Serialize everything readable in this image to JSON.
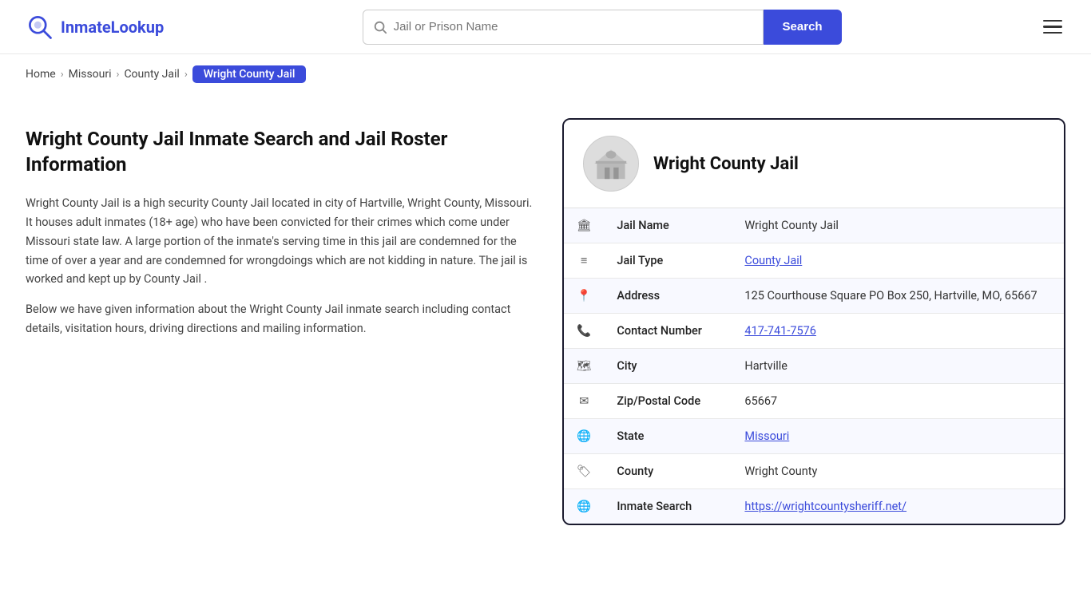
{
  "header": {
    "logo_text_prefix": "Inmate",
    "logo_text_suffix": "Lookup",
    "search_placeholder": "Jail or Prison Name",
    "search_button_label": "Search"
  },
  "breadcrumb": {
    "home": "Home",
    "state": "Missouri",
    "type": "County Jail",
    "current": "Wright County Jail"
  },
  "left_col": {
    "heading": "Wright County Jail Inmate Search and Jail Roster Information",
    "paragraph1": "Wright County Jail is a high security County Jail located in city of Hartville, Wright County, Missouri. It houses adult inmates (18+ age) who have been convicted for their crimes which come under Missouri state law. A large portion of the inmate's serving time in this jail are condemned for the time of over a year and are condemned for wrongdoings which are not kidding in nature. The jail is worked and kept up by County Jail .",
    "paragraph2": "Below we have given information about the Wright County Jail inmate search including contact details, visitation hours, driving directions and mailing information."
  },
  "card": {
    "title": "Wright County Jail",
    "rows": [
      {
        "icon": "jail-icon",
        "label": "Jail Name",
        "value": "Wright County Jail",
        "link": null
      },
      {
        "icon": "list-icon",
        "label": "Jail Type",
        "value": "County Jail",
        "link": "#"
      },
      {
        "icon": "pin-icon",
        "label": "Address",
        "value": "125 Courthouse Square PO Box 250, Hartville, MO, 65667",
        "link": null
      },
      {
        "icon": "phone-icon",
        "label": "Contact Number",
        "value": "417-741-7576",
        "link": "tel:417-741-7576"
      },
      {
        "icon": "city-icon",
        "label": "City",
        "value": "Hartville",
        "link": null
      },
      {
        "icon": "mail-icon",
        "label": "Zip/Postal Code",
        "value": "65667",
        "link": null
      },
      {
        "icon": "globe-icon",
        "label": "State",
        "value": "Missouri",
        "link": "#"
      },
      {
        "icon": "county-icon",
        "label": "County",
        "value": "Wright County",
        "link": null
      },
      {
        "icon": "search-globe-icon",
        "label": "Inmate Search",
        "value": "https://wrightcountysheriff.net/",
        "link": "https://wrightcountysheriff.net/"
      }
    ]
  },
  "icons": {
    "jail-icon": "🏛",
    "list-icon": "≡",
    "pin-icon": "📍",
    "phone-icon": "📞",
    "city-icon": "🗺",
    "mail-icon": "✉",
    "globe-icon": "🌐",
    "county-icon": "🏷",
    "search-globe-icon": "🌐"
  }
}
